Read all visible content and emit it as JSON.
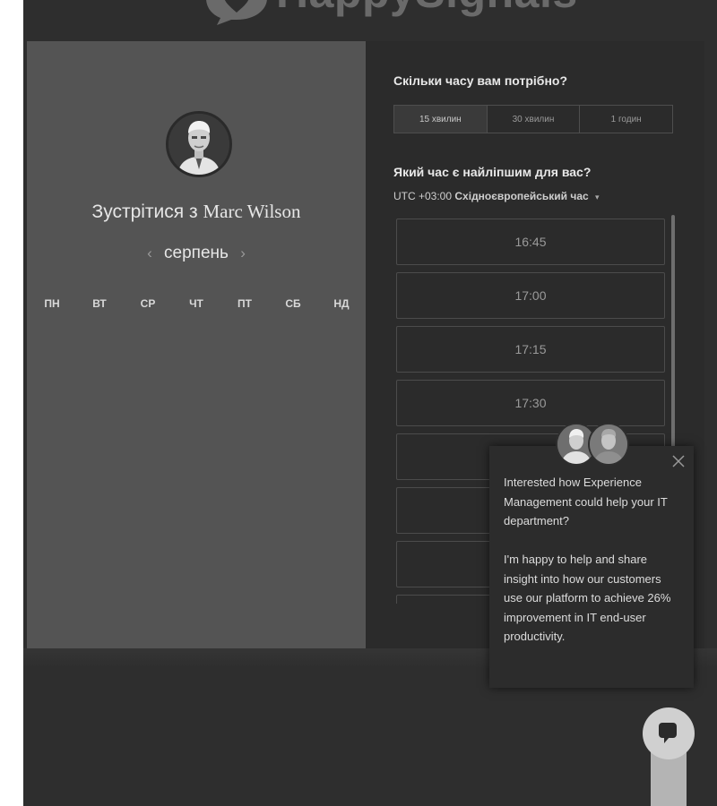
{
  "brand": {
    "name": "HappySignals"
  },
  "scheduler": {
    "left": {
      "meet_prefix": "Зустрітися з",
      "person_name": "Marc Wilson",
      "month_prev": "‹",
      "month_label": "серпень",
      "month_next": "›",
      "weekdays": [
        "ПН",
        "ВТ",
        "СР",
        "ЧТ",
        "ПТ",
        "СБ",
        "НД"
      ]
    },
    "right": {
      "duration_question": "Скільки часу вам потрібно?",
      "durations": [
        "15 хвилин",
        "30 хвилин",
        "1 годин"
      ],
      "selected_duration": "15 хвилин",
      "time_question": "Який час є найліпшим для вас?",
      "timezone_offset": "UTC +03:00",
      "timezone_name": "Східноєвропейський час",
      "timezone_caret": "▾",
      "slots": [
        "16:45",
        "17:00",
        "17:15",
        "17:30",
        "",
        "",
        "",
        ""
      ]
    }
  },
  "chat_popup": {
    "close_glyph": "×",
    "line1": "Interested how Experience Management could help your IT department?",
    "line2": "I'm happy to help and share insight into how our customers use our platform to achieve 26% improvement in IT end-user productivity."
  },
  "icons": {
    "brand_mark": "speech-bubble-heart-icon",
    "close": "close-icon",
    "chat": "chat-bubble-icon"
  },
  "colors": {
    "page_bg": "#2e2e2e",
    "left_panel_bg": "#545454",
    "right_panel_bg": "#2b2b2b",
    "slot_border": "#4c4c4c",
    "popup_bg": "#2c2c2c",
    "chat_button": "#d0d0d0"
  }
}
